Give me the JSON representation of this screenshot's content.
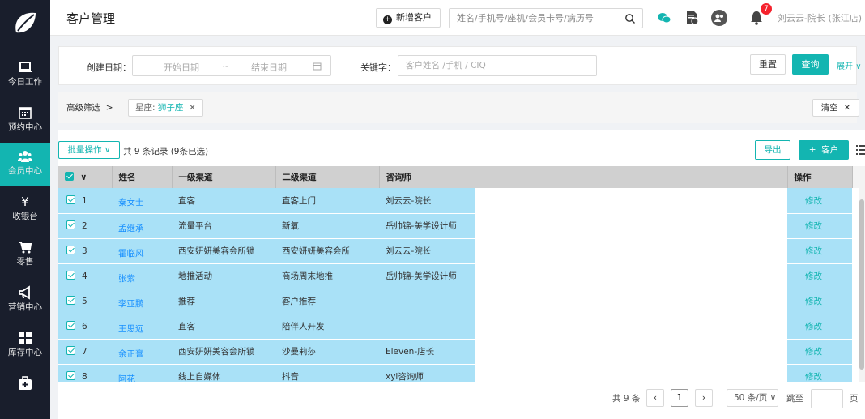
{
  "colors": {
    "accent": "#13b5b1",
    "sidebar": "#191e2c",
    "row_selected": "#a9e1f7",
    "badge": "#f5222d",
    "link": "#1890ff"
  },
  "sidebar": {
    "items": [
      {
        "label": "今日工作",
        "icon": "laptop-icon"
      },
      {
        "label": "预约中心",
        "icon": "calendar-icon"
      },
      {
        "label": "会员中心",
        "icon": "users-icon",
        "active": true
      },
      {
        "label": "收银台",
        "icon": "yen-icon"
      },
      {
        "label": "零售",
        "icon": "cart-icon"
      },
      {
        "label": "营销中心",
        "icon": "megaphone-icon"
      },
      {
        "label": "库存中心",
        "icon": "grid-icon"
      },
      {
        "label": "",
        "icon": "medkit-icon"
      }
    ]
  },
  "header": {
    "title": "客户管理",
    "new_customer_label": "新增客户",
    "search_placeholder": "姓名/手机号/座机/会员卡号/病历号",
    "notification_count": "7",
    "user": "刘云云-院长 (张江店)"
  },
  "filter": {
    "created_date_label": "创建日期：",
    "start_placeholder": "开始日期",
    "range_sep": "~",
    "end_placeholder": "结束日期",
    "keyword_label": "关键字：",
    "keyword_placeholder": "客户姓名 /手机 / CIQ",
    "reset_label": "重置",
    "query_label": "查询",
    "expand_label": "展开"
  },
  "advanced": {
    "label": "高级筛选",
    "tag_key": "星座:",
    "tag_value": "狮子座",
    "clear_label": "清空"
  },
  "toolbar": {
    "batch_label": "批量操作",
    "record_count": "共 9 条记录 (9条已选)",
    "export_label": "导出",
    "add_label": "客户"
  },
  "table": {
    "columns": [
      "姓名",
      "一级渠道",
      "二级渠道",
      "咨询师",
      "操作"
    ],
    "action_label": "修改",
    "rows": [
      {
        "idx": "1",
        "name": "秦女士",
        "ch1": "直客",
        "ch2": "直客上门",
        "consultant": "刘云云-院长"
      },
      {
        "idx": "2",
        "name": "孟继承",
        "ch1": "流量平台",
        "ch2": "新氧",
        "consultant": "岳帅锦-美学设计师"
      },
      {
        "idx": "3",
        "name": "霍临风",
        "ch1": "西安妍妍美容会所锁",
        "ch2": "西安妍妍美容会所",
        "consultant": "刘云云-院长"
      },
      {
        "idx": "4",
        "name": "张紫",
        "ch1": "地推活动",
        "ch2": "商场周末地推",
        "consultant": "岳帅锦-美学设计师"
      },
      {
        "idx": "5",
        "name": "李亚鹏",
        "ch1": "推荐",
        "ch2": "客户推荐",
        "consultant": ""
      },
      {
        "idx": "6",
        "name": "王思远",
        "ch1": "直客",
        "ch2": "陪伴人开发",
        "consultant": ""
      },
      {
        "idx": "7",
        "name": "余正膏",
        "ch1": "西安妍妍美容会所锁",
        "ch2": "沙曼莉莎",
        "consultant": "Eleven-店长"
      },
      {
        "idx": "8",
        "name": "阿花",
        "ch1": "线上自媒体",
        "ch2": "抖音",
        "consultant": "xyl咨询师"
      }
    ]
  },
  "pagination": {
    "total": "共 9 条",
    "current_page": "1",
    "page_size": "50 条/页",
    "jump_label": "跳至",
    "page_unit": "页"
  }
}
